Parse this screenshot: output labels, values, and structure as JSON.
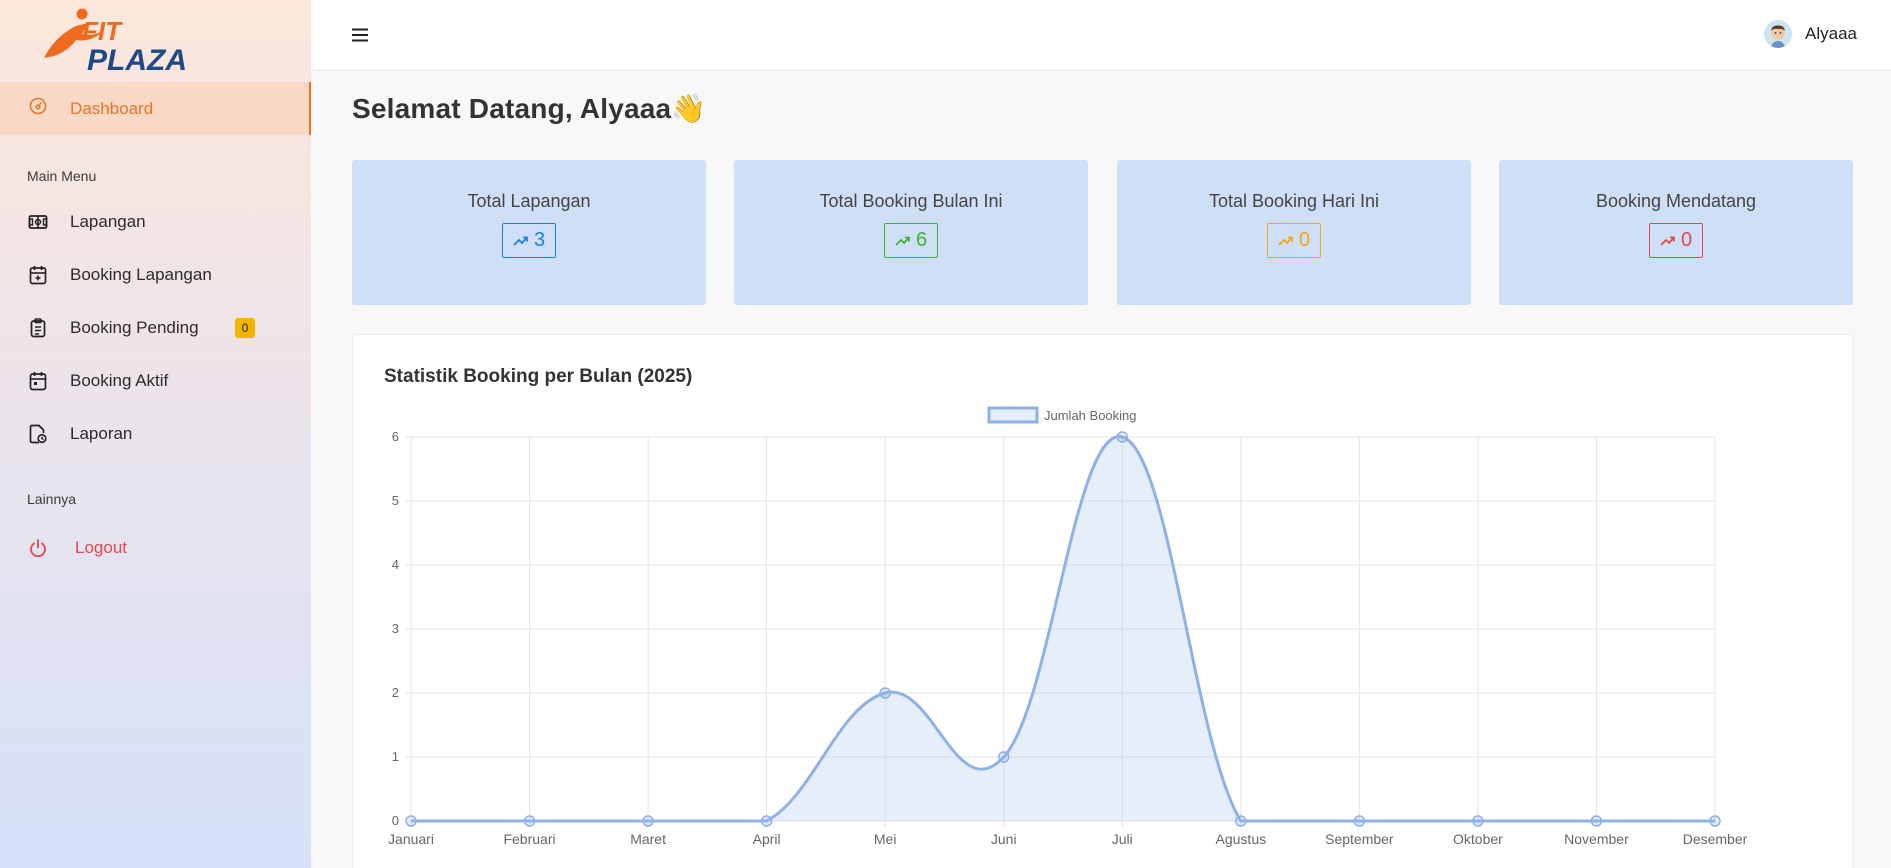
{
  "brand": {
    "line1": "FIT",
    "line2": "PLAZA"
  },
  "sidebar": {
    "active": {
      "label": "Dashboard",
      "icon": "gauge-icon"
    },
    "main_menu_label": "Main Menu",
    "items": [
      {
        "label": "Lapangan",
        "icon": "field-icon"
      },
      {
        "label": "Booking Lapangan",
        "icon": "calendar-plus-icon"
      },
      {
        "label": "Booking Pending",
        "icon": "clipboard-icon",
        "badge": "0"
      },
      {
        "label": "Booking Aktif",
        "icon": "calendar-icon"
      },
      {
        "label": "Laporan",
        "icon": "report-icon"
      }
    ],
    "other_label": "Lainnya",
    "logout_label": "Logout"
  },
  "header": {
    "user_name": "Alyaaa"
  },
  "page": {
    "title": "Selamat Datang, Alyaaa👋"
  },
  "stats": [
    {
      "label": "Total Lapangan",
      "value": "3",
      "color": "#1b7fe0"
    },
    {
      "label": "Total Booking Bulan Ini",
      "value": "6",
      "color": "#3bb62c"
    },
    {
      "label": "Total Booking Hari Ini",
      "value": "0",
      "color": "#f2a516"
    },
    {
      "label": "Booking Mendatang",
      "value": "0",
      "color": "#e24a4a"
    }
  ],
  "chart_title": "Statistik Booking per Bulan (2025)",
  "chart_data": {
    "type": "line",
    "categories": [
      "Januari",
      "Februari",
      "Maret",
      "April",
      "Mei",
      "Juni",
      "Juli",
      "Agustus",
      "September",
      "Oktober",
      "November",
      "Desember"
    ],
    "series": [
      {
        "name": "Jumlah Booking",
        "values": [
          0,
          0,
          0,
          0,
          2,
          1,
          6,
          0,
          0,
          0,
          0,
          0
        ],
        "color": "#8fb2e6"
      }
    ],
    "ylim": [
      0,
      6
    ],
    "yticks": [
      "0",
      "1",
      "2",
      "3",
      "4",
      "5",
      "6"
    ],
    "legend": "top",
    "grid": true,
    "fill": true
  }
}
